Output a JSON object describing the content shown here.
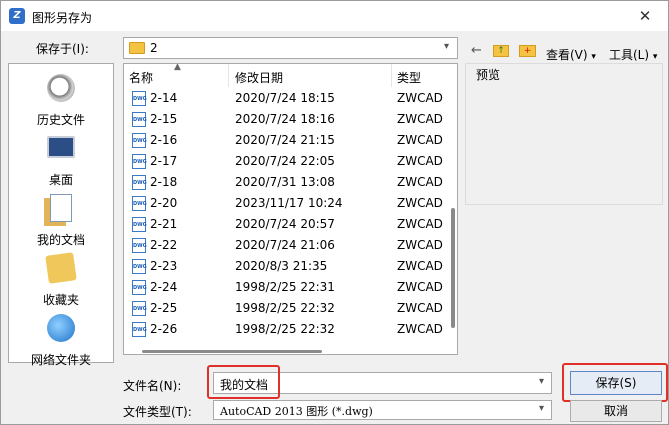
{
  "window": {
    "title": "图形另存为",
    "app_icon": "zwcad-icon",
    "close": "✕"
  },
  "lookin": {
    "label": "保存于(I):",
    "value": "2"
  },
  "toolbar": {
    "back": "←",
    "up": "↑",
    "new_folder": "+",
    "view_label": "查看(V)",
    "tools_label": "工具(L)",
    "dropdown": "▾"
  },
  "places": [
    {
      "label": "历史文件",
      "icon": "history-clock-icon"
    },
    {
      "label": "桌面",
      "icon": "desktop-icon"
    },
    {
      "label": "我的文档",
      "icon": "documents-icon"
    },
    {
      "label": "收藏夹",
      "icon": "favorites-icon"
    },
    {
      "label": "网络文件夹",
      "icon": "network-folder-icon"
    }
  ],
  "columns": {
    "name": "名称",
    "date": "修改日期",
    "type": "类型"
  },
  "files": [
    {
      "name": "2-14",
      "date": "2020/7/24 18:15",
      "type": "ZWCAD"
    },
    {
      "name": "2-15",
      "date": "2020/7/24 18:16",
      "type": "ZWCAD"
    },
    {
      "name": "2-16",
      "date": "2020/7/24 21:15",
      "type": "ZWCAD"
    },
    {
      "name": "2-17",
      "date": "2020/7/24 22:05",
      "type": "ZWCAD"
    },
    {
      "name": "2-18",
      "date": "2020/7/31 13:08",
      "type": "ZWCAD"
    },
    {
      "name": "2-20",
      "date": "2023/11/17 10:24",
      "type": "ZWCAD"
    },
    {
      "name": "2-21",
      "date": "2020/7/24 20:57",
      "type": "ZWCAD"
    },
    {
      "name": "2-22",
      "date": "2020/7/24 21:06",
      "type": "ZWCAD"
    },
    {
      "name": "2-23",
      "date": "2020/8/3 21:35",
      "type": "ZWCAD"
    },
    {
      "name": "2-24",
      "date": "1998/2/25 22:31",
      "type": "ZWCAD"
    },
    {
      "name": "2-25",
      "date": "1998/2/25 22:32",
      "type": "ZWCAD"
    },
    {
      "name": "2-26",
      "date": "1998/2/25 22:32",
      "type": "ZWCAD"
    }
  ],
  "file_icon_text": "DWG",
  "preview": {
    "label": "预览"
  },
  "filename": {
    "label": "文件名(N):",
    "value": "我的文档"
  },
  "filetype": {
    "label": "文件类型(T):",
    "value": "AutoCAD 2013 图形 (*.dwg)"
  },
  "buttons": {
    "save": "保存(S)",
    "cancel": "取消"
  }
}
